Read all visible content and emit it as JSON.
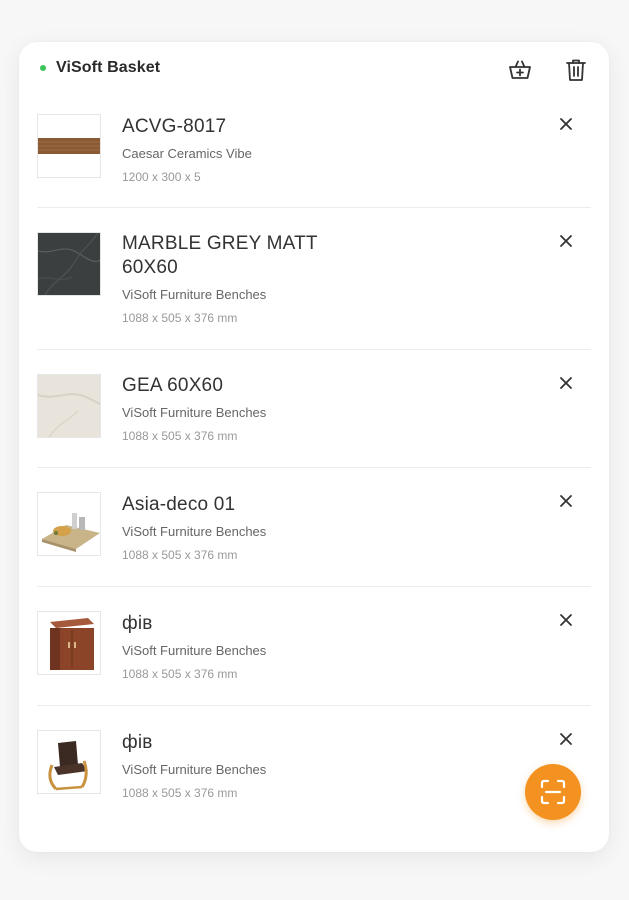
{
  "header": {
    "title": "ViSoft Basket",
    "status_color": "#3cc45a",
    "basket_icon": "basket-icon",
    "trash_icon": "trash-icon"
  },
  "items": [
    {
      "name": "ACVG-8017",
      "brand": "Caesar Ceramics Vibe",
      "dims": "1200 x 300 x 5",
      "thumb": "wood-tile"
    },
    {
      "name": "MARBLE GREY MATT 60X60",
      "brand": "ViSoft Furniture Benches",
      "dims": "1088 x 505 x 376 mm",
      "thumb": "dark-marble"
    },
    {
      "name": "GEA 60X60",
      "brand": "ViSoft Furniture Benches",
      "dims": "1088 x 505 x 376 mm",
      "thumb": "light-marble"
    },
    {
      "name": "Asia-deco 01",
      "brand": "ViSoft Furniture Benches",
      "dims": "1088 x 505 x 376 mm",
      "thumb": "deco-tray"
    },
    {
      "name": "фів",
      "brand": "ViSoft Furniture Benches",
      "dims": "1088 x 505 x 376 mm",
      "thumb": "wood-cabinet"
    },
    {
      "name": "фів",
      "brand": "ViSoft Furniture Benches",
      "dims": "1088 x 505 x 376 mm",
      "thumb": "armchair"
    }
  ],
  "fab": {
    "icon": "scan-icon",
    "color": "#f39220"
  }
}
